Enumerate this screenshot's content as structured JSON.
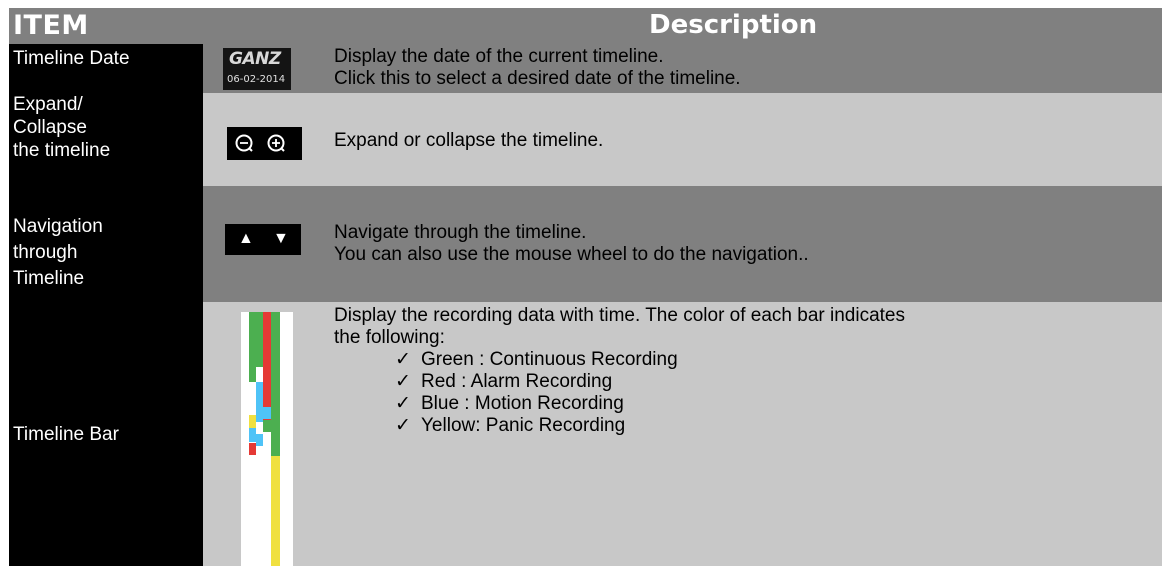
{
  "header": {
    "item": "ITEM",
    "description": "Description"
  },
  "rows": [
    {
      "label_lines": [
        "Timeline Date"
      ],
      "icon": {
        "logo": "GANZ",
        "date": "06-02-2014"
      },
      "desc_lines": [
        "Display the date of the current timeline.",
        "Click this to select a desired date of the timeline."
      ]
    },
    {
      "label_lines": [
        "Expand/",
        "Collapse",
        "the timeline"
      ],
      "icon": {
        "zoom_out": "zoom-out-icon",
        "zoom_in": "zoom-in-icon"
      },
      "desc_lines": [
        "Expand or collapse the timeline."
      ]
    },
    {
      "label_lines": [
        "Navigation",
        "through",
        "Timeline"
      ],
      "icon": {
        "up": "▲",
        "down": "▼"
      },
      "desc_lines": [
        "Navigate through the timeline.",
        "You can also use the mouse wheel to do the navigation.."
      ]
    },
    {
      "label_lines": [
        "Timeline Bar"
      ],
      "desc_lines": [
        "Display the recording data with time. The color of each bar indicates",
        "the following:"
      ],
      "check_mark": "✓",
      "bullets": [
        "Green : Continuous Recording",
        "Red : Alarm Recording",
        "Blue : Motion Recording",
        "Yellow: Panic Recording"
      ]
    }
  ],
  "colors": {
    "green": "#4caf50",
    "red": "#e53935",
    "blue": "#4fc3f7",
    "yellow": "#f0e040"
  }
}
